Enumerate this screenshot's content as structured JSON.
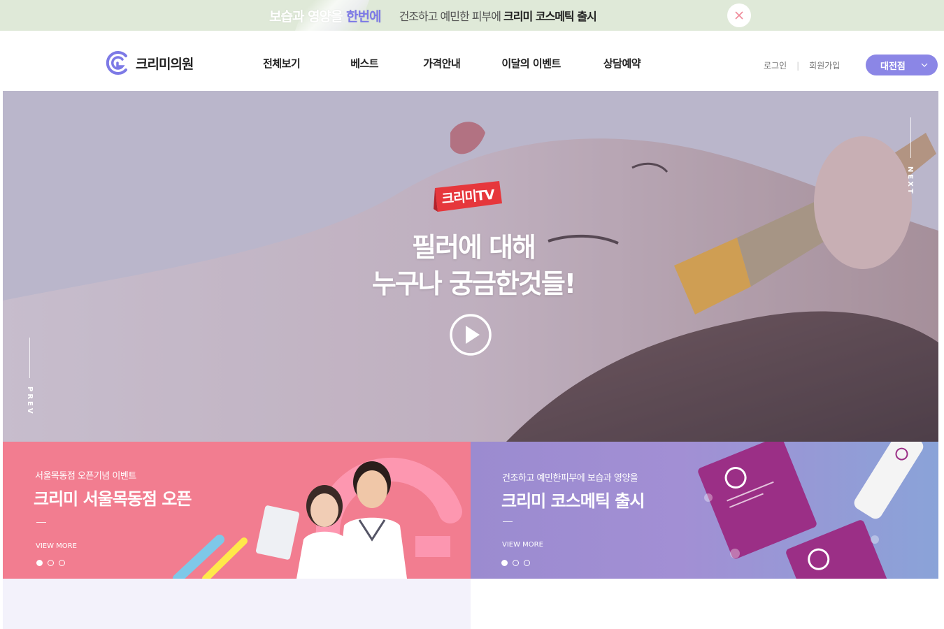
{
  "promo": {
    "headline_a": "보습과 영양을 ",
    "headline_b": "한번에",
    "sub_text": "건조하고 예민한 피부에 ",
    "sub_bold": "크리미 코스메틱 출시",
    "close_icon": "close-icon"
  },
  "header": {
    "logo_text": "크리미의원",
    "nav": [
      "전체보기",
      "베스트",
      "가격안내",
      "이달의 이벤트",
      "상담예약"
    ],
    "login": "로그인",
    "signup": "회원가입",
    "branch": "대전점",
    "colors": {
      "accent": "#8b86e6"
    }
  },
  "hero": {
    "badge": "크리미TV",
    "title_line1": "필러에 대해",
    "title_line2": "누구나 궁금한것들!",
    "next_label": "NEXT",
    "prev_label": "PREV",
    "play_icon": "play-icon"
  },
  "banners": [
    {
      "subtitle": "서울목동점 오픈기념 이벤트",
      "title": "크리미 서울목동점 오픈",
      "more": "VIEW MORE",
      "color": "#f27d90"
    },
    {
      "subtitle": "건조하고 예민한피부에 보습과 영양을",
      "title": "크리미 코스메틱 출시",
      "more": "VIEW MORE",
      "color": "#9b8bd0"
    }
  ]
}
